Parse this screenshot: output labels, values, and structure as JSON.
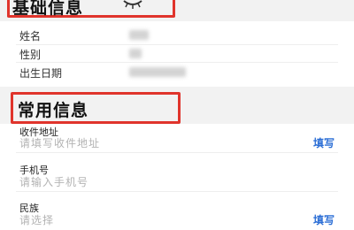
{
  "basic_info": {
    "title": "基础信息",
    "rows": [
      {
        "label": "姓名"
      },
      {
        "label": "性别"
      },
      {
        "label": "出生日期"
      }
    ]
  },
  "common_info": {
    "title": "常用信息",
    "fields": [
      {
        "label": "收件地址",
        "placeholder": "请填写收件地址",
        "action": "填写"
      },
      {
        "label": "手机号",
        "placeholder": "请输入手机号",
        "action": ""
      },
      {
        "label": "民族",
        "placeholder": "请选择",
        "action": "填写"
      }
    ]
  },
  "colors": {
    "highlight_box": "#e0342c",
    "link": "#2d6fd6"
  }
}
